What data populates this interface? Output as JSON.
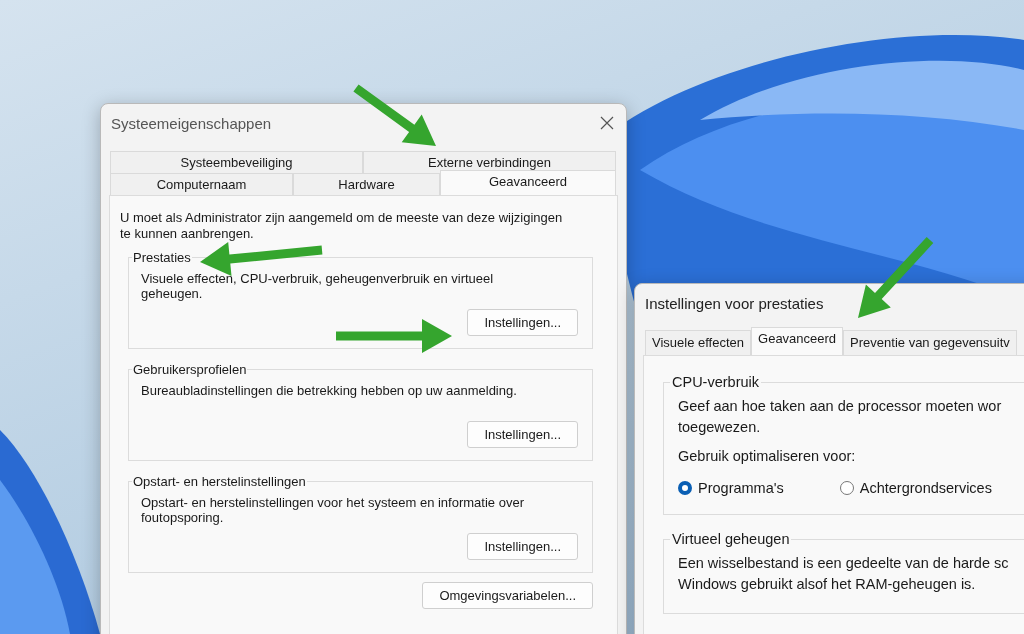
{
  "system_properties": {
    "title": "Systeemeigenschappen",
    "tab_rows": [
      [
        {
          "label": "Systeembeveiliging",
          "selected": false
        },
        {
          "label": "Externe verbindingen",
          "selected": false
        }
      ],
      [
        {
          "label": "Computernaam",
          "selected": false
        },
        {
          "label": "Hardware",
          "selected": false
        },
        {
          "label": "Geavanceerd",
          "selected": true
        }
      ]
    ],
    "notice": "U moet als Administrator zijn aangemeld om de meeste van deze wijzigingen te kunnen aanbrengen.",
    "groups": [
      {
        "title": "Prestaties",
        "description": "Visuele effecten, CPU-verbruik, geheugenverbruik en virtueel geheugen.",
        "button": "Instellingen..."
      },
      {
        "title": "Gebruikersprofielen",
        "description": "Bureaubladinstellingen die betrekking hebben op uw aanmelding.",
        "button": "Instellingen..."
      },
      {
        "title": "Opstart- en herstelinstellingen",
        "description": "Opstart- en herstelinstellingen voor het systeem en informatie over foutopsporing.",
        "button": "Instellingen..."
      }
    ],
    "button": "Omgevingsvariabelen..."
  },
  "performance_options": {
    "title": "Instellingen voor prestaties",
    "tabs": [
      {
        "label": "Visuele effecten",
        "selected": false
      },
      {
        "label": "Geavanceerd",
        "selected": true
      },
      {
        "label": "Preventie van gegevensuitv",
        "selected": false
      }
    ],
    "groups": [
      {
        "title": "CPU-verbruik",
        "lines": [
          "Geef aan hoe taken aan de processor moeten wor",
          "toegewezen."
        ],
        "prompt": "Gebruik optimaliseren voor:",
        "options": [
          {
            "label": "Programma's",
            "selected": true
          },
          {
            "label": "Achtergrondservices",
            "selected": false
          }
        ]
      },
      {
        "title": "Virtueel geheugen",
        "lines": [
          "Een wisselbestand is een gedeelte van de harde sc",
          "Windows gebruikt alsof het RAM-geheugen is."
        ]
      }
    ]
  }
}
